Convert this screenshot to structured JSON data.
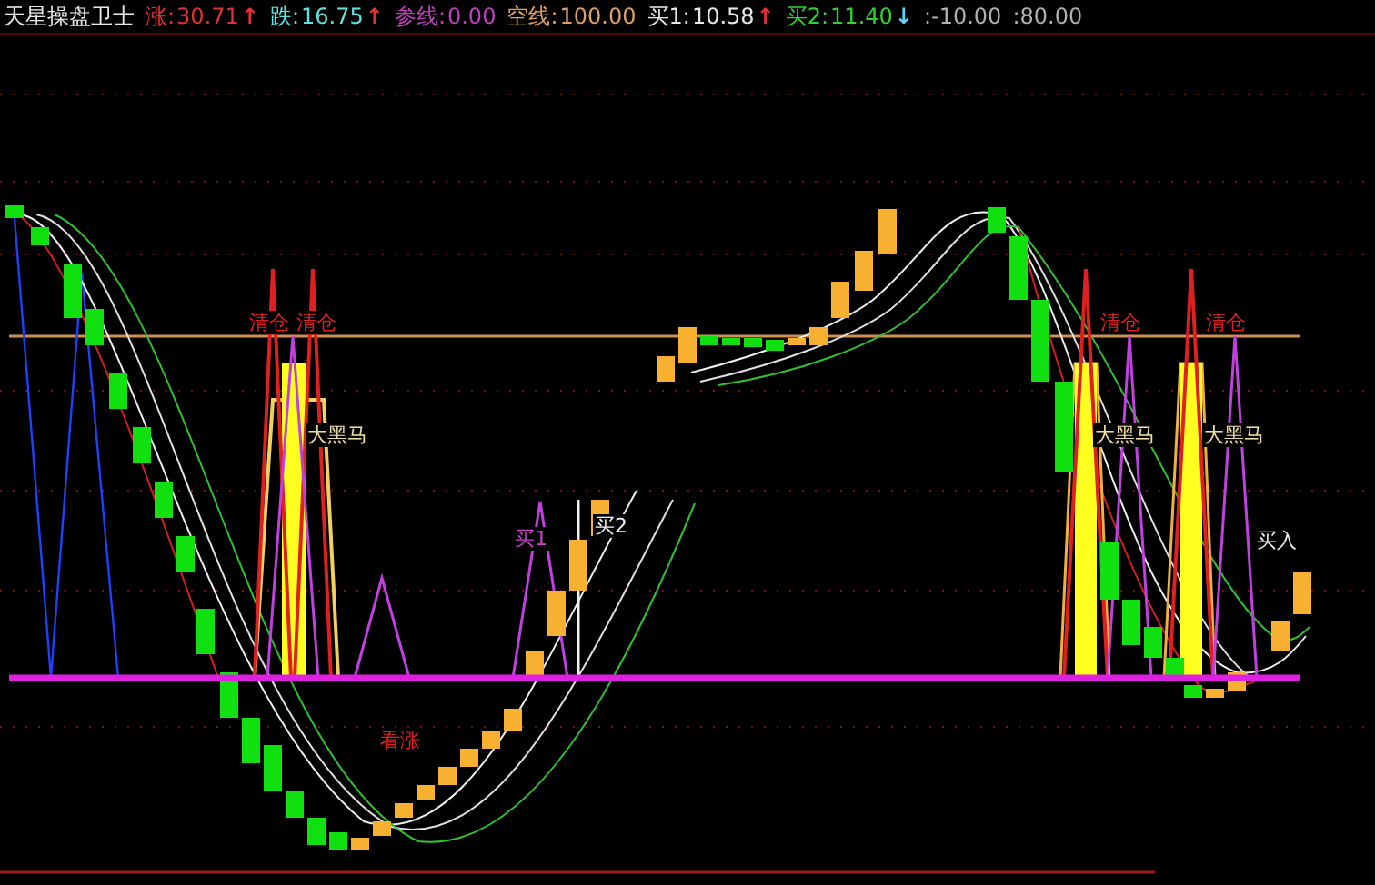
{
  "legend": {
    "title": "天星操盘卫士",
    "items": [
      {
        "label": "涨:",
        "value": "30.71",
        "color": "#e03030",
        "arrow": {
          "text": "↑",
          "color": "#e03030"
        }
      },
      {
        "label": "跌:",
        "value": "16.75",
        "color": "#60e0e0",
        "arrow": {
          "text": "↑",
          "color": "#e03030"
        }
      },
      {
        "label": "参线:",
        "value": "0.00",
        "color": "#c040c0"
      },
      {
        "label": "空线:",
        "value": "100.00",
        "color": "#e0a060"
      },
      {
        "label": "买1:",
        "value": "10.58",
        "color": "#e8e8e8",
        "arrow": {
          "text": "↑",
          "color": "#e03030"
        }
      },
      {
        "label": "买2:",
        "value": "11.40",
        "color": "#30d030",
        "arrow": {
          "text": "↓",
          "color": "#60d0f0"
        }
      },
      {
        "value": ":-10.00",
        "color": "#b0b0b0"
      },
      {
        "value": ":80.00",
        "color": "#b0b0b0"
      }
    ]
  },
  "chart": {
    "labels": [
      {
        "text": "清仓",
        "color": "#e02020"
      },
      {
        "text": "清仓",
        "color": "#e02020"
      },
      {
        "text": "大黑马",
        "color": "#f0e0a0"
      },
      {
        "text": "买1",
        "color": "#d040d0"
      },
      {
        "text": "买2",
        "color": "#f0f0f0"
      },
      {
        "text": "看涨",
        "color": "#e02020"
      },
      {
        "text": "清仓",
        "color": "#e02020"
      },
      {
        "text": "清仓",
        "color": "#e02020"
      },
      {
        "text": "大黑马",
        "color": "#f0e0a0"
      },
      {
        "text": "大黑马",
        "color": "#f0e0a0"
      },
      {
        "text": "买入",
        "color": "#f0f0f0"
      }
    ]
  }
}
